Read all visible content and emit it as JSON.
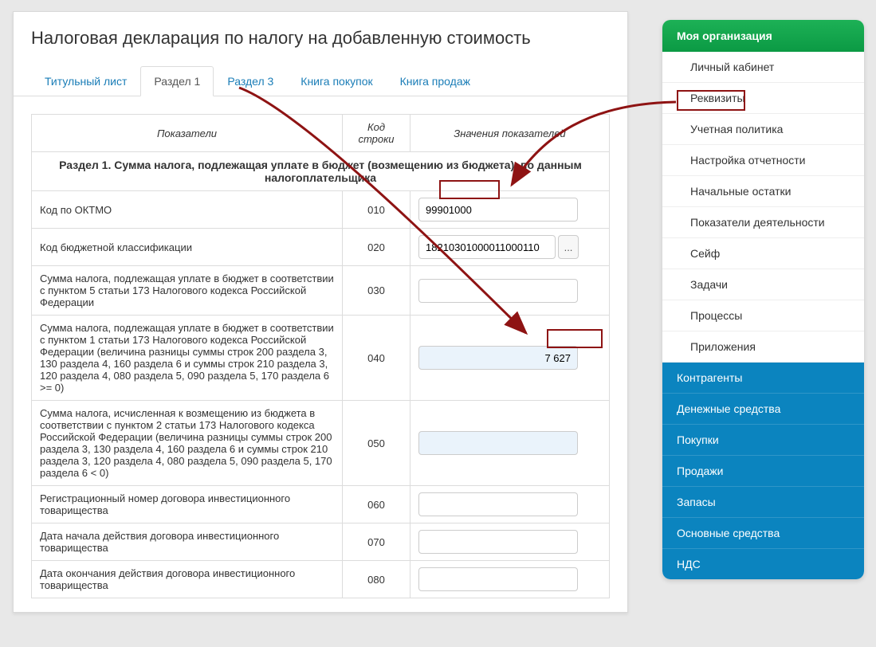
{
  "page_title": "Налоговая декларация по налогу на добавленную стоимость",
  "tabs": [
    {
      "label": "Титульный лист"
    },
    {
      "label": "Раздел 1"
    },
    {
      "label": "Раздел 3"
    },
    {
      "label": "Книга покупок"
    },
    {
      "label": "Книга продаж"
    }
  ],
  "active_tab_index": 1,
  "section": {
    "caption": "Раздел 1. Сумма налога, подлежащая уплате в бюджет (возмещению из бюджета), по данным налогоплательщика",
    "headers": {
      "indicator": "Показатели",
      "code": "Код строки",
      "value": "Значения показателей"
    },
    "rows": [
      {
        "indicator": "Код по ОКТМО",
        "code": "010",
        "value": "99901000",
        "type": "text"
      },
      {
        "indicator": "Код бюджетной классификации",
        "code": "020",
        "value": "18210301000011000110",
        "type": "kbk"
      },
      {
        "indicator": "Сумма налога, подлежащая уплате в бюджет в соответствии с пунктом 5 статьи 173 Налогового кодекса Российской Федерации",
        "code": "030",
        "value": "",
        "type": "text"
      },
      {
        "indicator": "Сумма налога, подлежащая уплате в бюджет в соответствии с пунктом 1 статьи 173 Налогового кодекса Российской Федерации (величина разницы суммы строк 200 раздела 3, 130 раздела 4, 160 раздела 6 и суммы строк 210 раздела 3, 120 раздела 4, 080 раздела 5, 090 раздела 5, 170 раздела 6 >= 0)",
        "code": "040",
        "value": "7 627",
        "type": "number-hl"
      },
      {
        "indicator": "Сумма налога, исчисленная к возмещению из бюджета в соответствии с пунктом 2 статьи 173 Налогового кодекса Российской Федерации (величина разницы суммы строк 200 раздела 3, 130 раздела 4, 160 раздела 6 и суммы строк 210 раздела 3, 120 раздела 4, 080 раздела 5, 090 раздела 5, 170 раздела 6 < 0)",
        "code": "050",
        "value": "",
        "type": "number-hl"
      },
      {
        "indicator": "Регистрационный номер договора инвестиционного товарищества",
        "code": "060",
        "value": "",
        "type": "text"
      },
      {
        "indicator": "Дата начала действия договора инвестиционного товарищества",
        "code": "070",
        "value": "",
        "type": "text"
      },
      {
        "indicator": "Дата окончания действия договора инвестиционного товарищества",
        "code": "080",
        "value": "",
        "type": "text"
      }
    ]
  },
  "ellipsis_label": "...",
  "sidebar": {
    "header": "Моя организация",
    "org_items": [
      "Личный кабинет",
      "Реквизиты",
      "Учетная политика",
      "Настройка отчетности",
      "Начальные остатки",
      "Показатели деятельности",
      "Сейф",
      "Задачи",
      "Процессы",
      "Приложения"
    ],
    "blue_items": [
      "Контрагенты",
      "Денежные средства",
      "Покупки",
      "Продажи",
      "Запасы",
      "Основные средства",
      "НДС"
    ]
  }
}
